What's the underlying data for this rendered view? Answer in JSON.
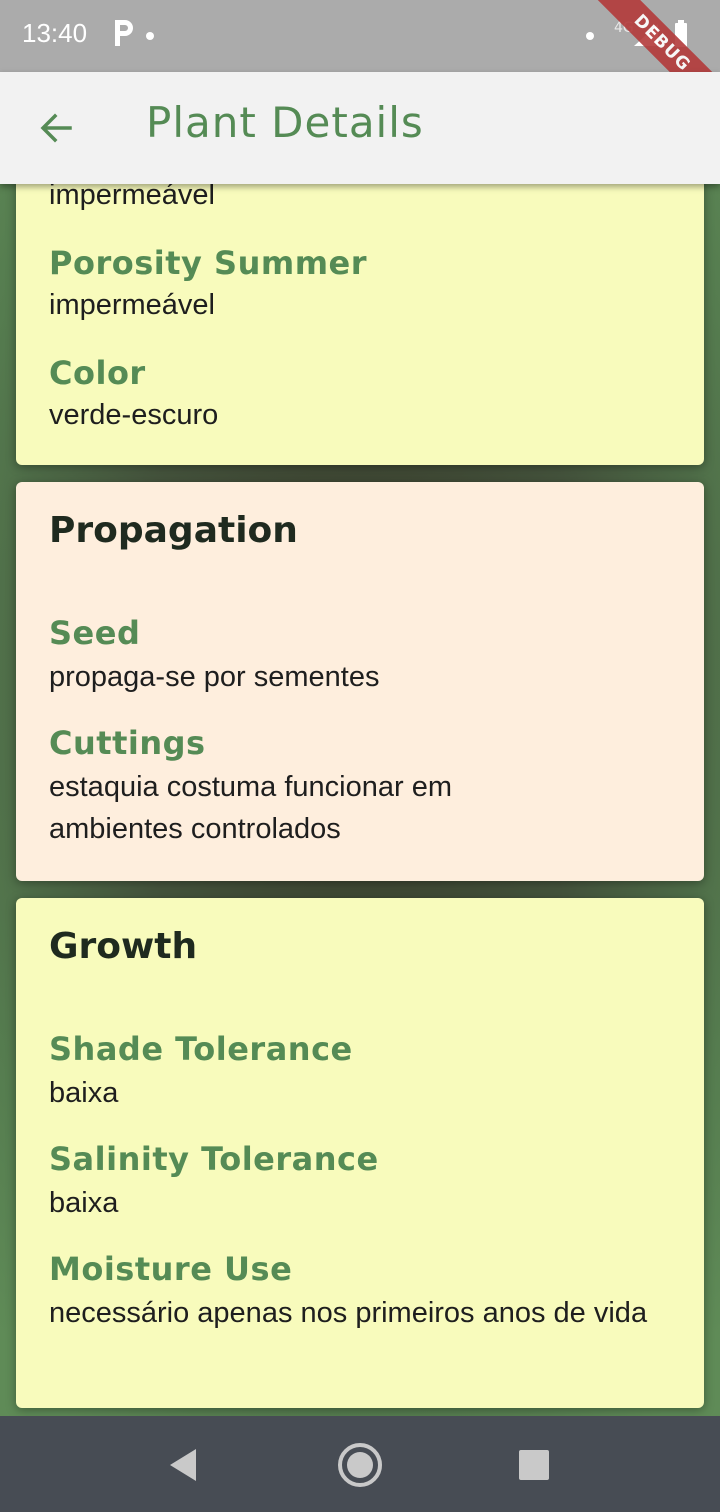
{
  "status_bar": {
    "time": "13:40",
    "network": "4G",
    "debug_label": "DEBUG"
  },
  "app_bar": {
    "title": "Plant Details",
    "back_icon": "arrow-back-icon"
  },
  "cards": {
    "partial": {
      "top_value": "impermeável",
      "fields": [
        {
          "label": "Porosity Summer",
          "value": "impermeável"
        },
        {
          "label": "Color",
          "value": "verde-escuro"
        }
      ]
    },
    "propagation": {
      "title": "Propagation",
      "fields": [
        {
          "label": "Seed",
          "value": "propaga-se por sementes"
        },
        {
          "label": "Cuttings",
          "value": "estaquia costuma funcionar em ambientes controlados"
        }
      ]
    },
    "growth": {
      "title": "Growth",
      "fields": [
        {
          "label": "Shade Tolerance",
          "value": "baixa"
        },
        {
          "label": "Salinity Tolerance",
          "value": "baixa"
        },
        {
          "label": "Moisture Use",
          "value": "necessário apenas nos primeiros anos de vida"
        }
      ]
    }
  },
  "colors": {
    "accent": "#558b55",
    "card_yellow": "#f8fbbc",
    "card_peach": "#feeedd",
    "nav_bar": "#474c54"
  },
  "nav_bar": {
    "buttons": [
      "back-triangle-icon",
      "home-circle-icon",
      "recents-square-icon"
    ]
  }
}
